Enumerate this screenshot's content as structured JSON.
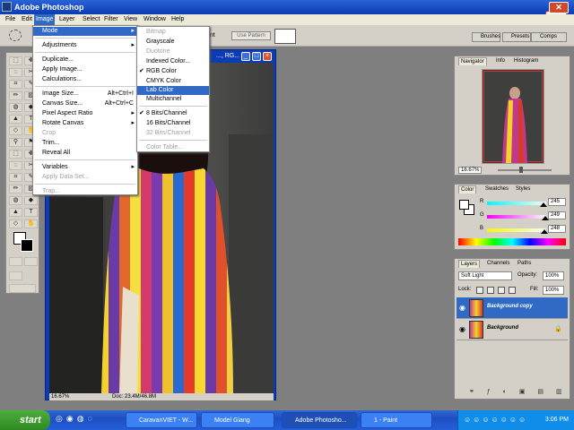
{
  "app": {
    "title": "Adobe Photoshop"
  },
  "menubar": [
    "File",
    "Edit",
    "Image",
    "Layer",
    "Select",
    "Filter",
    "View",
    "Window",
    "Help"
  ],
  "options": {
    "pattern_label": "Use Pattern",
    "partial_label": "ent"
  },
  "wells": [
    "Brushes",
    "Presets",
    "Comps"
  ],
  "image_menu": {
    "items": [
      {
        "label": "Mode",
        "shortcut": "",
        "submenu": true,
        "highlight": true,
        "disabled": false
      },
      {
        "label": "Adjustments",
        "shortcut": "",
        "submenu": true,
        "highlight": false,
        "disabled": false
      },
      {
        "label": "Duplicate...",
        "shortcut": "",
        "submenu": false,
        "highlight": false,
        "disabled": false
      },
      {
        "label": "Apply Image...",
        "shortcut": "",
        "submenu": false,
        "highlight": false,
        "disabled": false
      },
      {
        "label": "Calculations...",
        "shortcut": "",
        "submenu": false,
        "highlight": false,
        "disabled": false
      },
      {
        "label": "Image Size...",
        "shortcut": "Alt+Ctrl+I",
        "submenu": false,
        "highlight": false,
        "disabled": false
      },
      {
        "label": "Canvas Size...",
        "shortcut": "Alt+Ctrl+C",
        "submenu": false,
        "highlight": false,
        "disabled": false
      },
      {
        "label": "Pixel Aspect Ratio",
        "shortcut": "",
        "submenu": true,
        "highlight": false,
        "disabled": false
      },
      {
        "label": "Rotate Canvas",
        "shortcut": "",
        "submenu": true,
        "highlight": false,
        "disabled": false
      },
      {
        "label": "Crop",
        "shortcut": "",
        "submenu": false,
        "highlight": false,
        "disabled": true
      },
      {
        "label": "Trim...",
        "shortcut": "",
        "submenu": false,
        "highlight": false,
        "disabled": false
      },
      {
        "label": "Reveal All",
        "shortcut": "",
        "submenu": false,
        "highlight": false,
        "disabled": false
      },
      {
        "label": "Variables",
        "shortcut": "",
        "submenu": true,
        "highlight": false,
        "disabled": false
      },
      {
        "label": "Apply Data Set...",
        "shortcut": "",
        "submenu": false,
        "highlight": false,
        "disabled": true
      },
      {
        "label": "Trap...",
        "shortcut": "",
        "submenu": false,
        "highlight": false,
        "disabled": true
      }
    ]
  },
  "mode_menu": {
    "items": [
      {
        "label": "Bitmap",
        "checked": false,
        "disabled": true,
        "highlight": false
      },
      {
        "label": "Grayscale",
        "checked": false,
        "disabled": false,
        "highlight": false
      },
      {
        "label": "Duotone",
        "checked": false,
        "disabled": true,
        "highlight": false
      },
      {
        "label": "Indexed Color...",
        "checked": false,
        "disabled": false,
        "highlight": false
      },
      {
        "label": "RGB Color",
        "checked": true,
        "disabled": false,
        "highlight": false
      },
      {
        "label": "CMYK Color",
        "checked": false,
        "disabled": false,
        "highlight": false
      },
      {
        "label": "Lab Color",
        "checked": false,
        "disabled": false,
        "highlight": true
      },
      {
        "label": "Multichannel",
        "checked": false,
        "disabled": false,
        "highlight": false
      },
      {
        "label": "8 Bits/Channel",
        "checked": true,
        "disabled": false,
        "highlight": false
      },
      {
        "label": "16 Bits/Channel",
        "checked": false,
        "disabled": false,
        "highlight": false
      },
      {
        "label": "32 Bits/Channel",
        "checked": false,
        "disabled": true,
        "highlight": false
      },
      {
        "label": "Color Table...",
        "checked": false,
        "disabled": true,
        "highlight": false
      }
    ]
  },
  "document": {
    "title_fragment": "..., RG...",
    "zoom": "16.67%",
    "doc_size": "Doc: 23.4M/46.8M"
  },
  "navigator": {
    "tabs": [
      "Navigator",
      "Info",
      "Histogram"
    ],
    "zoom": "16.67%"
  },
  "color": {
    "tabs": [
      "Color",
      "Swatches",
      "Styles"
    ],
    "r_label": "R",
    "g_label": "G",
    "b_label": "B",
    "r": "245",
    "g": "249",
    "b": "248",
    "r_level": 0.96,
    "g_level": 0.98,
    "b_level": 0.97
  },
  "layers": {
    "tabs": [
      "Layers",
      "Channels",
      "Paths"
    ],
    "blend_mode": "Soft Light",
    "opacity_label": "Opacity:",
    "opacity": "100%",
    "lock_label": "Lock:",
    "fill_label": "Fill:",
    "fill": "100%",
    "items": [
      {
        "name": "Background copy",
        "selected": true
      },
      {
        "name": "Background",
        "selected": false
      }
    ]
  },
  "taskbar": {
    "start": "start",
    "tasks": [
      "CaravanVIET - W...",
      "Model Giang",
      "Adobe Photosho...",
      "1 - Paint"
    ],
    "clock": "3:06 PM"
  },
  "colors": {
    "xp_blue": "#0b3cb6",
    "menu_highlight": "#316ac5",
    "taskbar": "#245edb",
    "start_green": "#3a9a2e"
  }
}
